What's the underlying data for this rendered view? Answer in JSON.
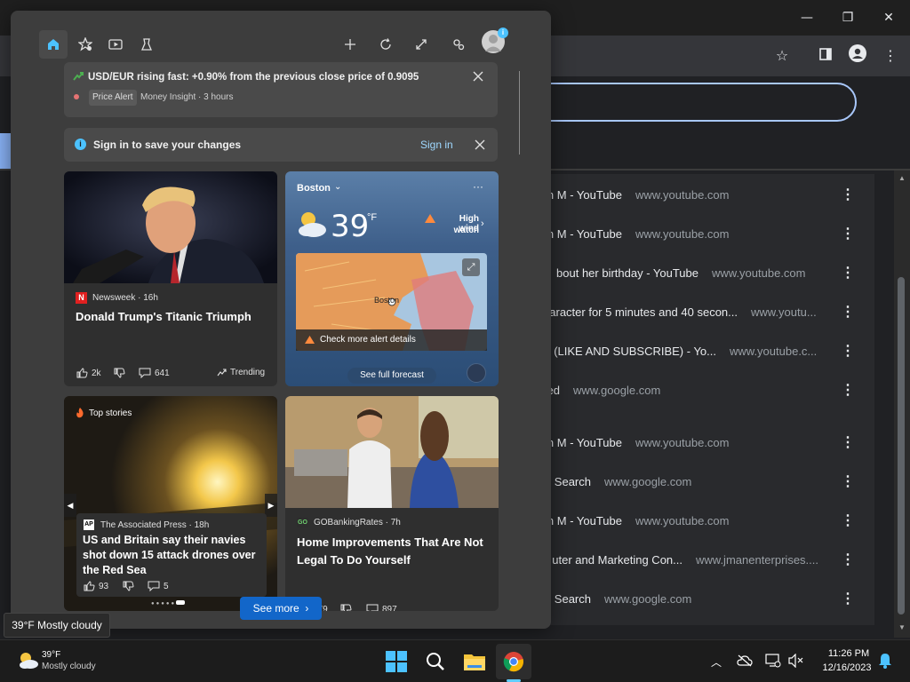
{
  "chrome": {
    "history": [
      {
        "title": "n M - YouTube",
        "domain": "www.youtube.com"
      },
      {
        "title": "n M - YouTube",
        "domain": "www.youtube.com"
      },
      {
        "title": "bout her birthday - YouTube",
        "domain": "www.youtube.com"
      },
      {
        "title": "haracter for 5 minutes and 40 secon...",
        "domain": "www.youtu..."
      },
      {
        "title": "One (LIKE AND SUBSCRIBE) - Yo...",
        "domain": "www.youtube.c..."
      },
      {
        "title": "ed",
        "domain": "www.google.com"
      },
      {
        "title": "n M - YouTube",
        "domain": "www.youtube.com"
      },
      {
        "title": "e Search",
        "domain": "www.google.com"
      },
      {
        "title": "n M - YouTube",
        "domain": "www.youtube.com"
      },
      {
        "title": "uter and Marketing Con...",
        "domain": "www.jmanenterprises...."
      },
      {
        "title": "e Search",
        "domain": "www.google.com"
      }
    ]
  },
  "widgets": {
    "alert": {
      "text": "USD/EUR rising fast: +0.90% from the previous close price of 0.9095",
      "tag": "Price Alert",
      "source": "Money Insight · 3 hours"
    },
    "signin": {
      "text": "Sign in to save your changes",
      "link": "Sign in"
    },
    "card1": {
      "source": "Newsweek · 16h",
      "title": "Donald Trump's Titanic Triumph",
      "likes": "2k",
      "comments": "641",
      "trending": "Trending"
    },
    "weather": {
      "city": "Boston",
      "temp": "39",
      "unit": "°F",
      "alert_line1": "High wind",
      "alert_line2": "watch",
      "map_label": "Boston",
      "details": "Check more alert details",
      "forecast": "See full forecast"
    },
    "card3": {
      "label": "Top stories",
      "source": "The Associated Press · 18h",
      "title": "US and Britain say their navies shot down 15 attack drones over the Red Sea",
      "likes": "93",
      "comments": "5"
    },
    "card4": {
      "source": "GOBankingRates · 7h",
      "title": "Home Improvements That Are Not Legal To Do Yourself",
      "likes": "579",
      "comments": "897"
    },
    "see_more": "See more"
  },
  "tooltip": "39°F Mostly cloudy",
  "taskbar": {
    "weather_temp": "39°F",
    "weather_desc": "Mostly cloudy",
    "time": "11:26 PM",
    "date": "12/16/2023"
  },
  "colors": {
    "accent": "#1266c9",
    "chrome_focus": "#a8c7fa",
    "info_icon": "#4cc2ff"
  }
}
